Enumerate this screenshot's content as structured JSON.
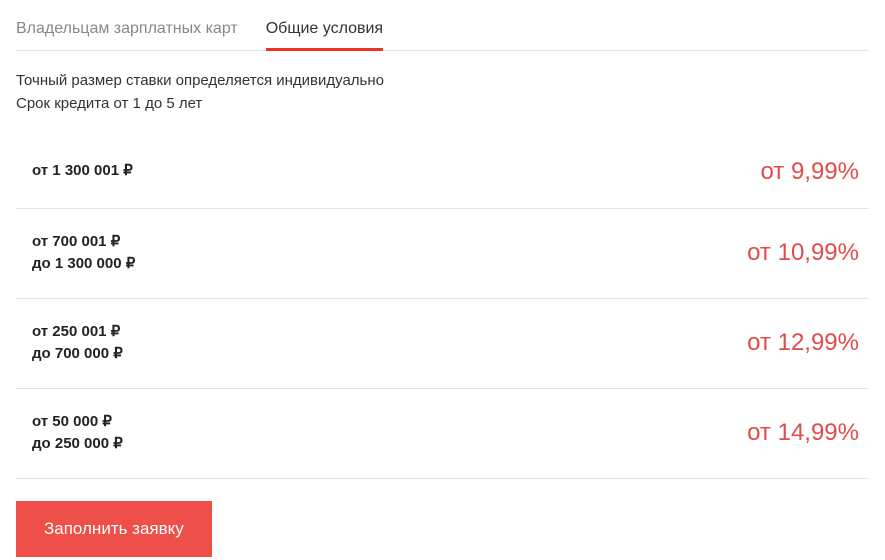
{
  "tabs": {
    "inactive": "Владельцам зарплатных карт",
    "active": "Общие условия"
  },
  "intro": {
    "line1": "Точный размер ставки определяется индивидуально",
    "line2": "Срок кредита от 1 до 5 лет"
  },
  "rows": [
    {
      "range_line1": "от 1  300 001 ₽",
      "range_line2": "",
      "rate": "от 9,99%"
    },
    {
      "range_line1": "от 700 001 ₽",
      "range_line2": "до 1 300 000 ₽",
      "rate": "от 10,99%"
    },
    {
      "range_line1": "от 250 001 ₽",
      "range_line2": "до 700 000 ₽",
      "rate": "от 12,99%"
    },
    {
      "range_line1": "от 50 000 ₽",
      "range_line2": "до 250 000 ₽",
      "rate": "от 14,99%"
    }
  ],
  "button": {
    "label": "Заполнить заявку"
  }
}
